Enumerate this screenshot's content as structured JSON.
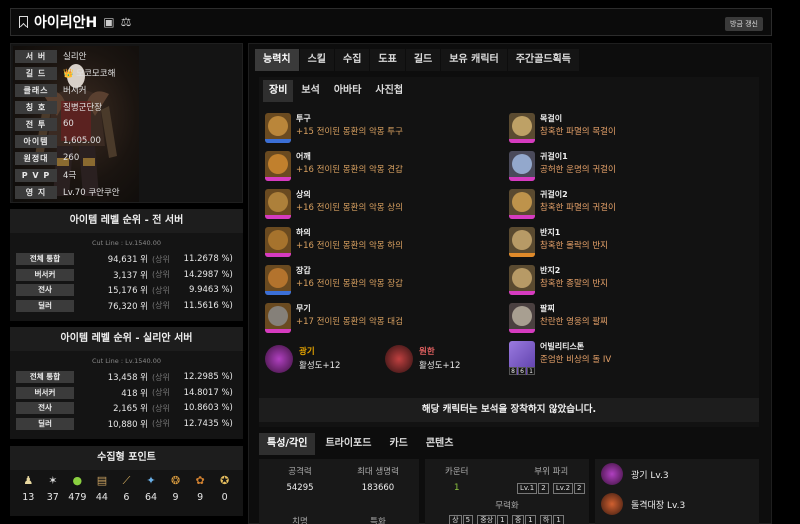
{
  "header": {
    "title": "아이리안H",
    "refresh_label": "방금 갱신"
  },
  "profile": {
    "rows": [
      {
        "label": "서 버",
        "value": "실리안"
      },
      {
        "label": "길 드",
        "value": "👑 모코모코해"
      },
      {
        "label": "클래스",
        "value": "버서커"
      },
      {
        "label": "칭 호",
        "value": "질병군단장"
      },
      {
        "label": "전 투",
        "value": "60"
      },
      {
        "label": "아이템",
        "value": "1,605.00"
      },
      {
        "label": "원정대",
        "value": "260"
      },
      {
        "label": "P V P",
        "value": "4극"
      },
      {
        "label": "영 지",
        "value": "Lv.70 쿠안쿠안"
      }
    ]
  },
  "rank_all": {
    "title": "아이템 레벨 순위 - 전 서버",
    "cutline": "Cut Line : Lv.1540.00",
    "rows": [
      {
        "label": "전체 통합",
        "rank": "94,631 위",
        "up": "(상위",
        "pct": "11.2678 %)"
      },
      {
        "label": "버서커",
        "rank": "3,137 위",
        "up": "(상위",
        "pct": "14.2987 %)"
      },
      {
        "label": "전사",
        "rank": "15,176 위",
        "up": "(상위",
        "pct": "9.9463 %)"
      },
      {
        "label": "딜러",
        "rank": "76,320 위",
        "up": "(상위",
        "pct": "11.5616 %)"
      }
    ]
  },
  "rank_server": {
    "title": "아이템 레벨 순위 - 실리안 서버",
    "cutline": "Cut Line : Lv.1540.00",
    "rows": [
      {
        "label": "전체 통합",
        "rank": "13,458 위",
        "up": "(상위",
        "pct": "12.2985 %)"
      },
      {
        "label": "버서커",
        "rank": "418 위",
        "up": "(상위",
        "pct": "14.8017 %)"
      },
      {
        "label": "전사",
        "rank": "2,165 위",
        "up": "(상위",
        "pct": "10.8603 %)"
      },
      {
        "label": "딜러",
        "rank": "10,880 위",
        "up": "(상위",
        "pct": "12.7435 %)"
      }
    ]
  },
  "collect": {
    "title": "수집형 포인트",
    "items": [
      {
        "icon": "island-heart-icon",
        "value": "13"
      },
      {
        "icon": "orpheus-star-icon",
        "value": "37"
      },
      {
        "icon": "mokoko-seed-icon",
        "value": "479"
      },
      {
        "icon": "great-art-icon",
        "value": "44"
      },
      {
        "icon": "giant-heart-icon",
        "value": "6"
      },
      {
        "icon": "ignea-token-icon",
        "value": "64"
      },
      {
        "icon": "sea-bounty-icon",
        "value": "9"
      },
      {
        "icon": "world-tree-leaf-icon",
        "value": "9"
      },
      {
        "icon": "omnium-star-icon",
        "value": "0"
      }
    ]
  },
  "tabs": [
    "능력치",
    "스킬",
    "수집",
    "도표",
    "길드",
    "보유 캐릭터",
    "주간골드획득"
  ],
  "subtabs": [
    "장비",
    "보석",
    "아바타",
    "사진첩"
  ],
  "equipment_left": [
    {
      "name": "투구",
      "desc": "+15 전이된 몽환의 악몽 투구",
      "bar": "#3b6fd6"
    },
    {
      "name": "어깨",
      "desc": "+16 전이된 몽환의 악몽 견갑",
      "bar": "#d63bc0"
    },
    {
      "name": "상의",
      "desc": "+16 전이된 몽환의 악몽 상의",
      "bar": "#d63bc0"
    },
    {
      "name": "하의",
      "desc": "+16 전이된 몽환의 악몽 하의",
      "bar": "#d63bc0"
    },
    {
      "name": "장갑",
      "desc": "+16 전이된 몽환의 악몽 장갑",
      "bar": "#3b6fd6"
    },
    {
      "name": "무기",
      "desc": "+17 전이된 몽환의 악몽 대검",
      "bar": "#d63bc0"
    }
  ],
  "equipment_right": [
    {
      "name": "목걸이",
      "desc": "참혹한 파멸의 목걸이",
      "bar": "#d63bc0"
    },
    {
      "name": "귀걸이1",
      "desc": "공허한 운명의 귀걸이",
      "bar": "#d63bc0"
    },
    {
      "name": "귀걸이2",
      "desc": "참혹한 파멸의 귀걸이",
      "bar": "#d63bc0"
    },
    {
      "name": "반지1",
      "desc": "참혹한 몰락의 반지",
      "bar": "#e08a2a"
    },
    {
      "name": "반지2",
      "desc": "참혹한 종말의 반지",
      "bar": "#d63bc0"
    },
    {
      "name": "팔찌",
      "desc": "찬란한 영웅의 팔찌",
      "bar": "#d63bc0"
    }
  ],
  "engravings_bottom": [
    {
      "name": "광기",
      "value": "활성도+12"
    },
    {
      "name": "원한",
      "value": "활성도+12"
    }
  ],
  "stone": {
    "name": "어빌리티스톤",
    "desc": "준엄한 비상의 돌 IV",
    "nums": [
      "8",
      "6",
      "1"
    ]
  },
  "gem_notice": "해당 캐릭터는 보석을 장착하지 않았습니다.",
  "tabs2": [
    "특성/각인",
    "트라이포드",
    "카드",
    "콘텐츠"
  ],
  "stats": {
    "attack_label": "공격력",
    "attack_value": "54295",
    "hp_label": "최대 생명력",
    "hp_value": "183660",
    "crit_label": "치명",
    "spec_label": "특화"
  },
  "combat": {
    "counter_label": "카운터",
    "counter_value": "1",
    "part_label": "부위 파괴",
    "part_lv1": "Lv.1",
    "part_lv1_count": "2",
    "part_lv2": "Lv.2",
    "part_lv2_count": "2",
    "neutral_label": "무력화",
    "neutral_items": [
      {
        "label": "상",
        "count": "5"
      },
      {
        "label": "중상",
        "count": "1"
      },
      {
        "label": "중",
        "count": "1"
      },
      {
        "label": "하",
        "count": "1"
      }
    ]
  },
  "engraving_list": [
    {
      "label": "광기 Lv.3"
    },
    {
      "label": "돌격대장 Lv.3"
    }
  ],
  "colors": {
    "madness": "#e0a000",
    "grudge": "#e06060"
  }
}
